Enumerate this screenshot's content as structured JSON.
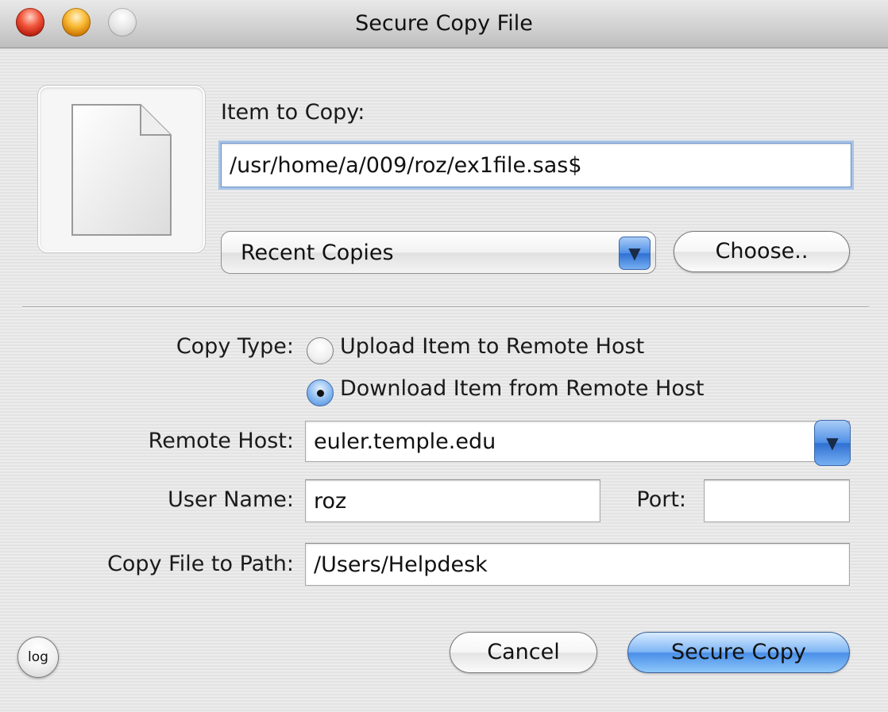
{
  "window": {
    "title": "Secure Copy File"
  },
  "item_to_copy": {
    "label": "Item to Copy:",
    "value": "/usr/home/a/009/roz/ex1file.sas$",
    "recent_label": "Recent Copies",
    "choose_label": "Choose.."
  },
  "copy_type": {
    "label": "Copy Type:",
    "options": [
      {
        "label": "Upload Item to Remote Host",
        "selected": false
      },
      {
        "label": "Download Item from Remote Host",
        "selected": true
      }
    ]
  },
  "remote_host": {
    "label": "Remote Host:",
    "value": "euler.temple.edu"
  },
  "user_name": {
    "label": "User Name:",
    "value": "roz"
  },
  "port": {
    "label": "Port:",
    "value": ""
  },
  "copy_path": {
    "label": "Copy File to Path:",
    "value": "/Users/Helpdesk"
  },
  "buttons": {
    "log": "log",
    "cancel": "Cancel",
    "secure_copy": "Secure Copy"
  },
  "colors": {
    "accent_blue": "#4b8fe8",
    "close_red": "#f2553b",
    "minimize_yellow": "#f9b933"
  },
  "icons": {
    "file": "document-icon",
    "popup_arrow": "chevron-down-icon"
  }
}
